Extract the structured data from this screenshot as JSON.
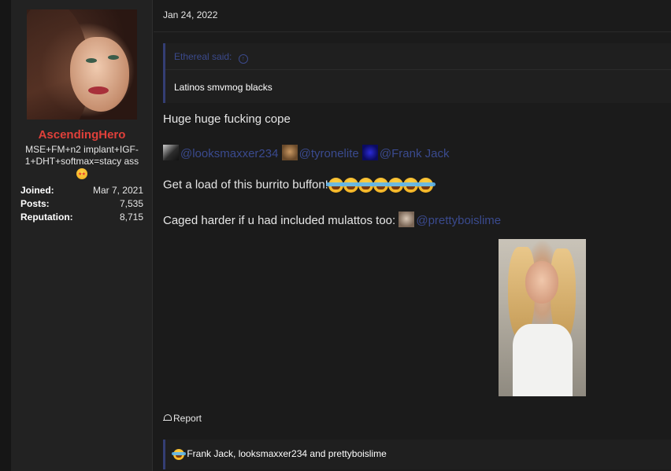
{
  "user": {
    "username": "AscendingHero",
    "title": "MSE+FM+n2 implant+IGF-1+DHT+softmax=stacy ass",
    "title_emoji": "star-struck-emoji",
    "stats": [
      {
        "key": "Joined:",
        "value": "Mar 7, 2021"
      },
      {
        "key": "Posts:",
        "value": "7,535"
      },
      {
        "key": "Reputation:",
        "value": "8,715"
      }
    ]
  },
  "post": {
    "date": "Jan 24, 2022",
    "quote": {
      "author_label": "Ethereal said:",
      "arrow_icon": "↑",
      "body": "Latinos smvmog blacks"
    },
    "line1": "Huge huge fucking cope",
    "mentions": [
      "@looksmaxxer234",
      "@tyronelite",
      "@Frank Jack"
    ],
    "line3": "Get a load of this burrito buffon!",
    "line3_emoji_count": 7,
    "line4": "Caged harder if u had included mulattos too: ",
    "line4_mention": "@prettyboislime",
    "report_label": "Report",
    "reactions_text": "Frank Jack, looksmaxxer234 and prettyboislime"
  },
  "colors": {
    "background": "#1b1b1b",
    "panel": "#222222",
    "username": "#e0403a",
    "mention": "#3a4a8e",
    "quote_border": "#343e74"
  }
}
